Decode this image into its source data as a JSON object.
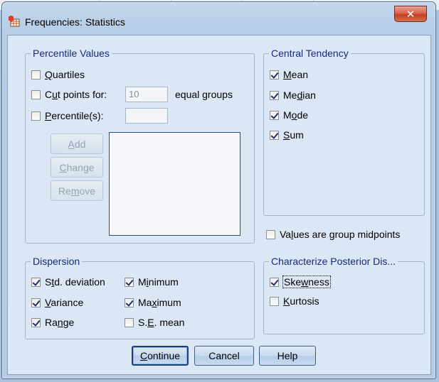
{
  "window": {
    "title": "Frequencies: Statistics",
    "close_glyph": "✕"
  },
  "percentile": {
    "legend": "Percentile Values",
    "quartiles": {
      "label_pre": "",
      "label_u": "Q",
      "label_post": "uartiles",
      "checked": false
    },
    "cutpoints": {
      "label_pre": "C",
      "label_u": "u",
      "label_post": "t points for:",
      "checked": false,
      "value": "10",
      "suffix": "equal groups"
    },
    "percentiles": {
      "label_pre": "",
      "label_u": "P",
      "label_post": "ercentile(s):",
      "checked": false,
      "value": ""
    },
    "buttons": {
      "add": {
        "pre": "",
        "u": "A",
        "post": "dd"
      },
      "change": {
        "pre": "",
        "u": "C",
        "post": "hange"
      },
      "remove": {
        "pre": "Re",
        "u": "m",
        "post": "ove"
      }
    }
  },
  "central": {
    "legend": "Central Tendency",
    "mean": {
      "pre": "",
      "u": "M",
      "post": "ean",
      "checked": true
    },
    "median": {
      "pre": "Me",
      "u": "d",
      "post": "ian",
      "checked": true
    },
    "mode": {
      "pre": "M",
      "u": "o",
      "post": "de",
      "checked": true
    },
    "sum": {
      "pre": "",
      "u": "S",
      "post": "um",
      "checked": true
    }
  },
  "midpoints": {
    "pre": "Va",
    "u": "l",
    "post": "ues are group midpoints",
    "checked": false
  },
  "dispersion": {
    "legend": "Dispersion",
    "std": {
      "pre": "S",
      "u": "t",
      "post": "d. deviation",
      "checked": true
    },
    "minimum": {
      "pre": "M",
      "u": "i",
      "post": "nimum",
      "checked": true
    },
    "variance": {
      "pre": "",
      "u": "V",
      "post": "ariance",
      "checked": true
    },
    "maximum": {
      "pre": "Ma",
      "u": "x",
      "post": "imum",
      "checked": true
    },
    "range": {
      "pre": "Ra",
      "u": "n",
      "post": "ge",
      "checked": true
    },
    "semean": {
      "pre": "S.",
      "u": "E",
      "post": ". mean",
      "checked": false
    }
  },
  "posterior": {
    "legend": "Characterize Posterior Dis...",
    "skewness": {
      "pre": "Ske",
      "u": "w",
      "post": "ness",
      "checked": true
    },
    "kurtosis": {
      "pre": "",
      "u": "K",
      "post": "urtosis",
      "checked": false
    }
  },
  "footer": {
    "continue": {
      "pre": "",
      "u": "C",
      "post": "ontinue"
    },
    "cancel": "Cancel",
    "help": "Help"
  }
}
